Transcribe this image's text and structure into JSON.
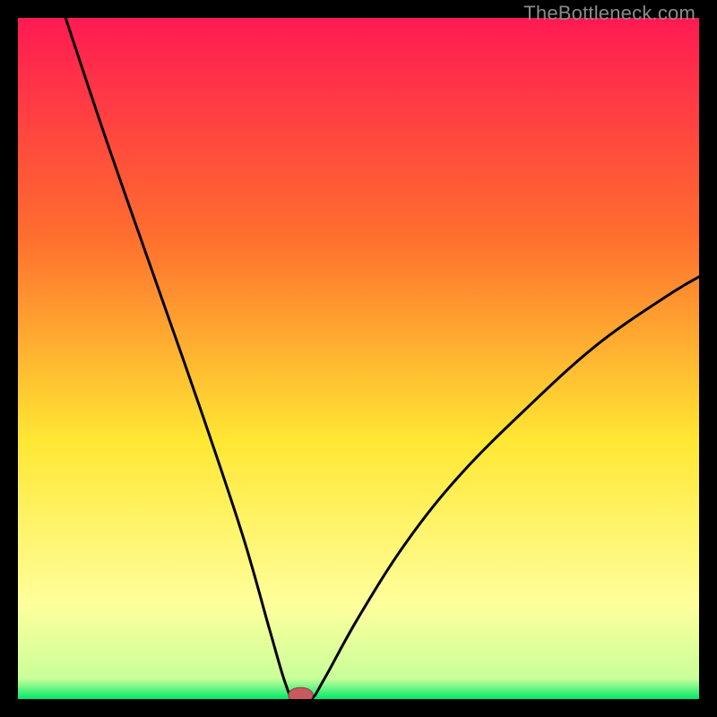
{
  "watermark": "TheBottleneck.com",
  "colors": {
    "black": "#000000",
    "gradient_top": "#ff1a52",
    "gradient_upper": "#ff6e2e",
    "gradient_mid": "#ffe733",
    "gradient_lower": "#ffff9c",
    "gradient_bottom": "#00e96b",
    "curve": "#000000",
    "marker_fill": "#c85a5f",
    "marker_stroke": "#8d3a3e"
  },
  "chart_data": {
    "type": "line",
    "title": "",
    "xlabel": "",
    "ylabel": "",
    "xlim": [
      0,
      100
    ],
    "ylim": [
      0,
      100
    ],
    "series": [
      {
        "name": "bottleneck-curve",
        "x_reference": 40.5,
        "points": [
          {
            "x": 7,
            "y": 100
          },
          {
            "x": 13,
            "y": 82
          },
          {
            "x": 20,
            "y": 62
          },
          {
            "x": 27,
            "y": 42
          },
          {
            "x": 33,
            "y": 24
          },
          {
            "x": 37,
            "y": 10
          },
          {
            "x": 39.2,
            "y": 2.5
          },
          {
            "x": 40.5,
            "y": 0
          },
          {
            "x": 43,
            "y": 0
          },
          {
            "x": 45,
            "y": 3
          },
          {
            "x": 50,
            "y": 12
          },
          {
            "x": 57,
            "y": 23
          },
          {
            "x": 65,
            "y": 33
          },
          {
            "x": 75,
            "y": 43
          },
          {
            "x": 85,
            "y": 52
          },
          {
            "x": 95,
            "y": 59
          },
          {
            "x": 100,
            "y": 62
          }
        ]
      }
    ],
    "marker": {
      "x": 41.5,
      "y": 0.6,
      "rx": 1.8,
      "ry": 1.1
    }
  }
}
